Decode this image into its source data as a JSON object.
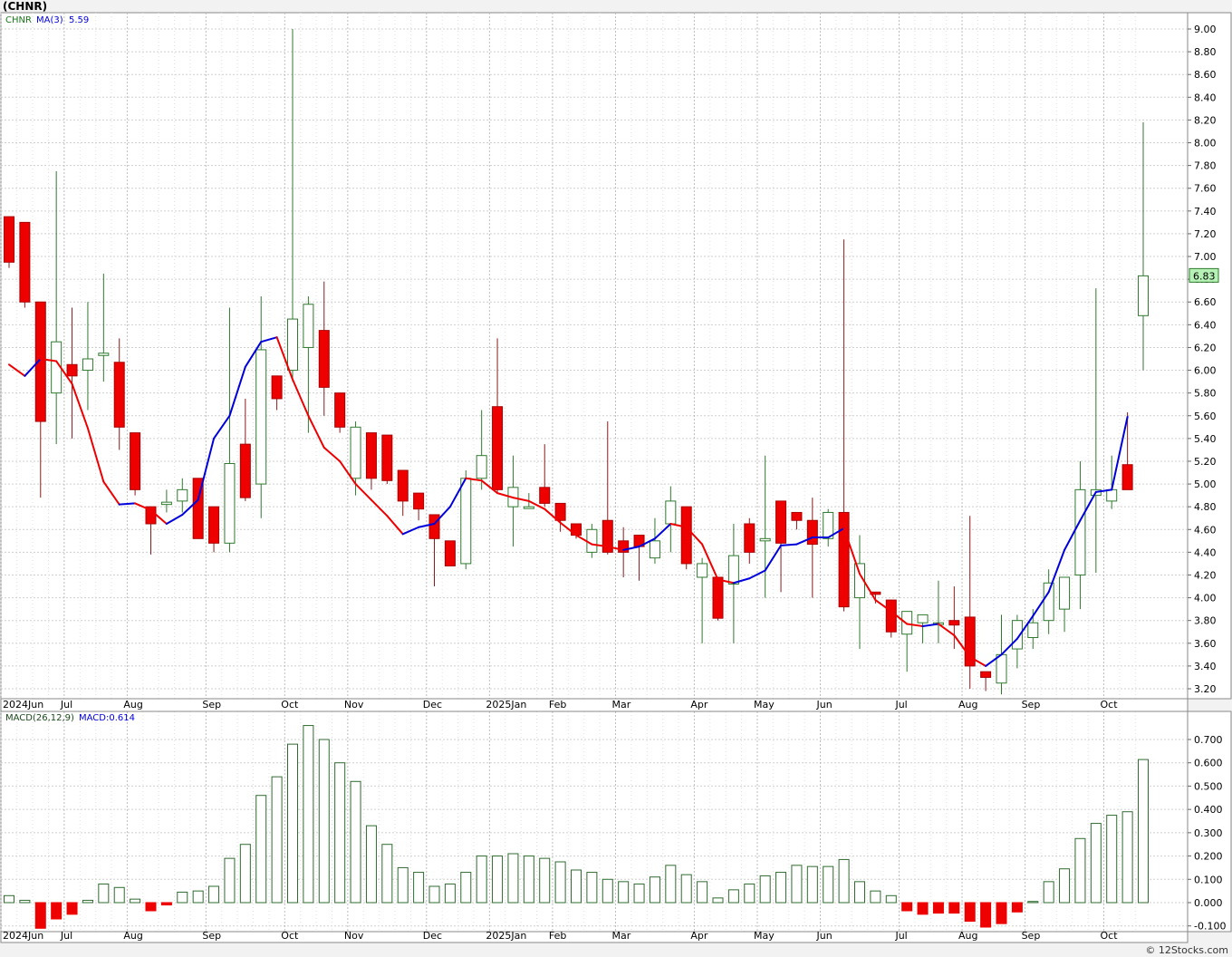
{
  "title": "(CHNR)",
  "credit": "© 12Stocks.com",
  "price_panel": {
    "legend_symbol": "CHNR",
    "legend_ma": "MA(3)",
    "legend_ma_value": "5.59",
    "last_price_label": "6.83",
    "colors": {
      "down_fill": "#ee0000",
      "up_fill": "#ffffff",
      "up_wick": "#2f7a2f",
      "down_wick": "#8b1a1a",
      "ma_up": "#0000dd",
      "ma_down": "#ee0000",
      "label_bg": "#b6f2b6"
    }
  },
  "macd_panel": {
    "legend_macd": "MACD(26,12,9)",
    "legend_value": "MACD:0.614",
    "colors": {
      "positive": "#2f6b2f",
      "negative": "#ee0000"
    }
  },
  "chart_data": [
    {
      "type": "candlestick",
      "title": "(CHNR)",
      "ylim": [
        3.1,
        9.1
      ],
      "y_ticks": [
        "9.00",
        "8.80",
        "8.60",
        "8.40",
        "8.20",
        "8.00",
        "7.80",
        "7.60",
        "7.40",
        "7.20",
        "7.00",
        "6.80",
        "6.60",
        "6.40",
        "6.20",
        "6.00",
        "5.80",
        "5.60",
        "5.40",
        "5.20",
        "5.00",
        "4.80",
        "4.60",
        "4.40",
        "4.20",
        "4.00",
        "3.80",
        "3.60",
        "3.40",
        "3.20"
      ],
      "x_ticks": [
        "2024Jun",
        "Jul",
        "Aug",
        "Sep",
        "Oct",
        "Nov",
        "Dec",
        "2025Jan",
        "Feb",
        "Mar",
        "Apr",
        "May",
        "Jun",
        "Jul",
        "Aug",
        "Sep",
        "Oct"
      ],
      "grid": true,
      "series": [
        {
          "name": "CHNR",
          "ohlc": [
            [
              7.35,
              7.35,
              6.9,
              6.95
            ],
            [
              7.3,
              7.3,
              6.55,
              6.6
            ],
            [
              6.6,
              6.6,
              4.88,
              5.55
            ],
            [
              5.8,
              7.75,
              5.35,
              6.25
            ],
            [
              6.05,
              6.55,
              5.4,
              5.95
            ],
            [
              6.0,
              6.6,
              5.65,
              6.1
            ],
            [
              6.13,
              6.85,
              5.9,
              6.15
            ],
            [
              6.07,
              6.28,
              5.3,
              5.5
            ],
            [
              5.45,
              5.45,
              4.9,
              4.95
            ],
            [
              4.8,
              4.8,
              4.38,
              4.65
            ],
            [
              4.82,
              4.95,
              4.75,
              4.84
            ],
            [
              4.85,
              5.05,
              4.75,
              4.95
            ],
            [
              5.05,
              5.05,
              4.52,
              4.52
            ],
            [
              4.8,
              4.8,
              4.4,
              4.48
            ],
            [
              4.48,
              6.55,
              4.4,
              5.18
            ],
            [
              5.35,
              5.75,
              4.85,
              4.88
            ],
            [
              5.0,
              6.65,
              4.7,
              6.18
            ],
            [
              5.95,
              5.95,
              5.65,
              5.75
            ],
            [
              6.0,
              9.0,
              5.9,
              6.45
            ],
            [
              6.2,
              6.65,
              5.45,
              6.58
            ],
            [
              6.35,
              6.78,
              5.6,
              5.85
            ],
            [
              5.8,
              5.8,
              5.45,
              5.5
            ],
            [
              5.05,
              5.55,
              4.9,
              5.5
            ],
            [
              5.45,
              5.45,
              4.95,
              5.05
            ],
            [
              5.43,
              5.43,
              5.0,
              5.03
            ],
            [
              5.12,
              5.12,
              4.72,
              4.85
            ],
            [
              4.92,
              4.92,
              4.68,
              4.78
            ],
            [
              4.73,
              4.73,
              4.1,
              4.52
            ],
            [
              4.5,
              4.5,
              4.33,
              4.28
            ],
            [
              4.3,
              5.12,
              4.25,
              5.05
            ],
            [
              5.05,
              5.65,
              4.95,
              5.25
            ],
            [
              5.68,
              6.28,
              4.92,
              4.95
            ],
            [
              4.8,
              5.25,
              4.45,
              4.97
            ],
            [
              4.8,
              4.92,
              4.8,
              4.8
            ],
            [
              4.97,
              5.35,
              4.8,
              4.83
            ],
            [
              4.83,
              4.83,
              4.58,
              4.68
            ],
            [
              4.65,
              4.65,
              4.52,
              4.55
            ],
            [
              4.4,
              4.65,
              4.35,
              4.6
            ],
            [
              4.68,
              5.55,
              4.38,
              4.4
            ],
            [
              4.5,
              4.62,
              4.18,
              4.4
            ],
            [
              4.55,
              4.55,
              4.15,
              4.45
            ],
            [
              4.35,
              4.7,
              4.3,
              4.5
            ],
            [
              4.65,
              4.98,
              4.4,
              4.85
            ],
            [
              4.8,
              4.8,
              4.25,
              4.3
            ],
            [
              4.18,
              4.35,
              3.6,
              4.3
            ],
            [
              4.18,
              4.18,
              3.8,
              3.82
            ],
            [
              4.12,
              4.65,
              3.6,
              4.37
            ],
            [
              4.65,
              4.7,
              4.3,
              4.4
            ],
            [
              4.5,
              5.25,
              4.0,
              4.52
            ],
            [
              4.85,
              4.85,
              4.05,
              4.48
            ],
            [
              4.75,
              4.75,
              4.6,
              4.68
            ],
            [
              4.68,
              4.88,
              4.0,
              4.47
            ],
            [
              4.52,
              4.78,
              4.45,
              4.75
            ],
            [
              4.75,
              7.15,
              3.88,
              3.92
            ],
            [
              4.0,
              4.55,
              3.55,
              4.3
            ],
            [
              4.05,
              4.05,
              3.95,
              4.03
            ],
            [
              3.98,
              3.98,
              3.65,
              3.7
            ],
            [
              3.68,
              3.85,
              3.35,
              3.88
            ],
            [
              3.78,
              3.82,
              3.6,
              3.85
            ],
            [
              3.77,
              4.15,
              3.6,
              3.78
            ],
            [
              3.8,
              4.1,
              3.55,
              3.76
            ],
            [
              3.83,
              4.72,
              3.2,
              3.4
            ],
            [
              3.35,
              3.35,
              3.18,
              3.3
            ],
            [
              3.25,
              3.85,
              3.15,
              3.5
            ],
            [
              3.55,
              3.85,
              3.38,
              3.8
            ],
            [
              3.65,
              3.9,
              3.55,
              3.78
            ],
            [
              3.8,
              4.25,
              3.68,
              4.13
            ],
            [
              3.9,
              4.1,
              3.7,
              4.18
            ],
            [
              4.2,
              5.2,
              3.9,
              4.95
            ],
            [
              4.9,
              6.72,
              4.22,
              4.95
            ],
            [
              4.85,
              5.25,
              4.78,
              4.95
            ],
            [
              5.17,
              5.63,
              4.95,
              4.95
            ],
            [
              6.48,
              8.18,
              6.0,
              6.83
            ]
          ]
        },
        {
          "name": "MA(3)",
          "values": [
            6.05,
            5.95,
            6.1,
            6.08,
            5.88,
            5.49,
            5.02,
            4.82,
            4.83,
            4.77,
            4.65,
            4.73,
            4.86,
            5.4,
            5.6,
            6.03,
            6.25,
            6.29,
            5.92,
            5.6,
            5.32,
            5.2,
            5.0,
            4.86,
            4.72,
            4.56,
            4.62,
            4.65,
            4.8,
            5.05,
            5.03,
            4.92,
            4.88,
            4.85,
            4.78,
            4.66,
            4.55,
            4.47,
            4.45,
            4.42,
            4.45,
            4.52,
            4.65,
            4.62,
            4.47,
            4.16,
            4.13,
            4.17,
            4.24,
            4.46,
            4.47,
            4.53,
            4.53,
            4.61,
            4.21,
            3.98,
            3.88,
            3.77,
            3.75,
            3.77,
            3.67,
            3.48,
            3.4,
            3.5,
            3.64,
            3.84,
            4.05,
            4.42,
            4.68,
            4.93,
            4.95,
            5.59
          ]
        }
      ]
    },
    {
      "type": "bar",
      "title": "MACD(26,12,9)",
      "ylim": [
        -0.12,
        0.78
      ],
      "y_ticks": [
        "0.700",
        "0.600",
        "0.500",
        "0.400",
        "0.300",
        "0.200",
        "0.100",
        "0.000",
        "-0.100"
      ],
      "x_ticks": [
        "2024Jun",
        "Jul",
        "Aug",
        "Sep",
        "Oct",
        "Nov",
        "Dec",
        "2025Jan",
        "Feb",
        "Mar",
        "Apr",
        "May",
        "Jun",
        "Jul",
        "Aug",
        "Sep",
        "Oct"
      ],
      "grid": true,
      "values": [
        0.03,
        0.01,
        -0.11,
        -0.07,
        -0.05,
        0.01,
        0.08,
        0.065,
        0.015,
        -0.035,
        -0.01,
        0.045,
        0.05,
        0.07,
        0.19,
        0.25,
        0.46,
        0.54,
        0.68,
        0.76,
        0.7,
        0.6,
        0.52,
        0.33,
        0.25,
        0.15,
        0.13,
        0.07,
        0.08,
        0.13,
        0.2,
        0.2,
        0.21,
        0.2,
        0.19,
        0.175,
        0.14,
        0.13,
        0.1,
        0.09,
        0.08,
        0.11,
        0.16,
        0.12,
        0.09,
        0.02,
        0.055,
        0.08,
        0.115,
        0.13,
        0.16,
        0.155,
        0.155,
        0.185,
        0.09,
        0.05,
        0.03,
        -0.035,
        -0.05,
        -0.045,
        -0.045,
        -0.08,
        -0.105,
        -0.09,
        -0.04,
        0.005,
        0.09,
        0.145,
        0.275,
        0.34,
        0.375,
        0.39,
        0.614
      ]
    }
  ]
}
